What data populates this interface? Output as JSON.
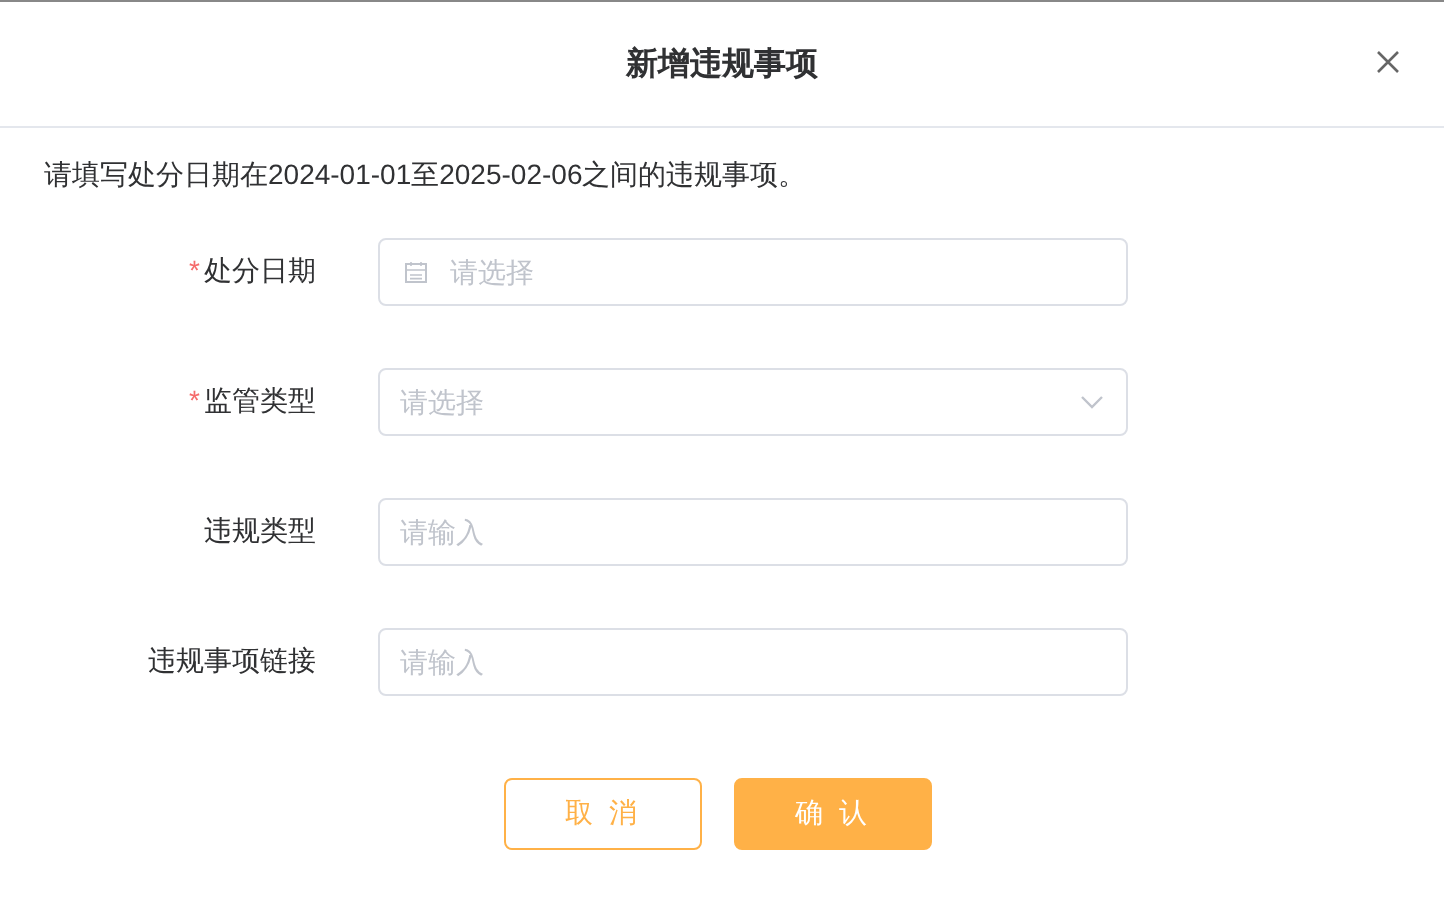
{
  "dialog": {
    "title": "新增违规事项",
    "notice": "请填写处分日期在2024-01-01至2025-02-06之间的违规事项。",
    "fields": [
      {
        "label": "处分日期",
        "required": true,
        "required_mark": "*",
        "kind": "date",
        "placeholder": "请选择"
      },
      {
        "label": "监管类型",
        "required": true,
        "required_mark": "*",
        "kind": "select",
        "placeholder": "请选择"
      },
      {
        "label": "违规类型",
        "required": false,
        "kind": "input",
        "placeholder": "请输入"
      },
      {
        "label": "违规事项链接",
        "required": false,
        "kind": "input",
        "placeholder": "请输入"
      }
    ],
    "buttons": [
      {
        "label": "取 消",
        "kind": "secondary"
      },
      {
        "label": "确 认",
        "kind": "primary"
      }
    ]
  }
}
